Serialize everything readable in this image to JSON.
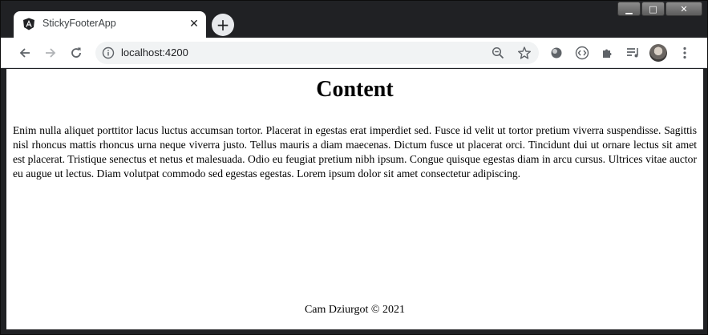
{
  "browser": {
    "tab": {
      "title": "StickyFooterApp",
      "favicon": "angular-icon",
      "close_glyph": "✕"
    },
    "new_tab_glyph": "+",
    "omnibox": {
      "url": "localhost:4200"
    },
    "window_controls": {
      "minimize": "▁",
      "maximize": "□",
      "close": "✕"
    }
  },
  "page": {
    "title": "Content",
    "body": "Enim nulla aliquet porttitor lacus luctus accumsan tortor. Placerat in egestas erat imperdiet sed. Fusce id velit ut tortor pretium viverra suspendisse. Sagittis nisl rhoncus mattis rhoncus urna neque viverra justo. Tellus mauris a diam maecenas. Dictum fusce ut placerat orci. Tincidunt dui ut ornare lectus sit amet est placerat. Tristique senectus et netus et malesuada. Odio eu feugiat pretium nibh ipsum. Congue quisque egestas diam in arcu cursus. Ultrices vitae auctor eu augue ut lectus. Diam volutpat commodo sed egestas egestas. Lorem ipsum dolor sit amet consectetur adipiscing.",
    "footer": "Cam Dziurgot © 2021"
  }
}
